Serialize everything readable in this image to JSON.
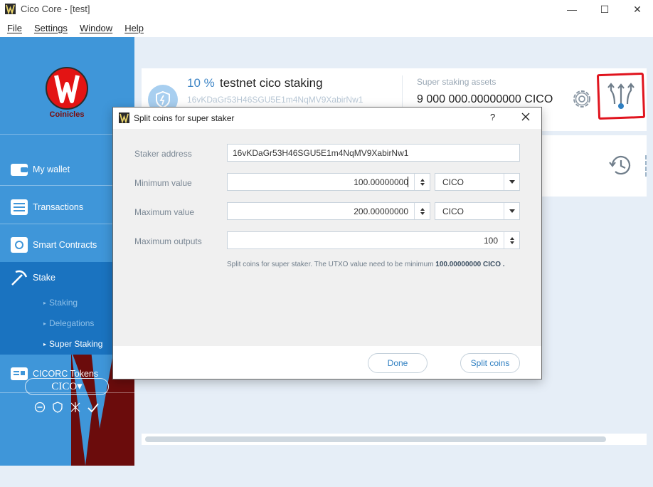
{
  "window": {
    "title": "Cico Core - [test]",
    "min_glyph": "—",
    "max_glyph": "☐",
    "close_glyph": "✕"
  },
  "menu": [
    "File",
    "Settings",
    "Window",
    "Help"
  ],
  "sidebar": {
    "logo_text": "Coinicles",
    "nav": {
      "wallet": "My wallet",
      "transactions": "Transactions",
      "contracts": "Smart Contracts",
      "stake": "Stake",
      "tokens": "CICORC Tokens"
    },
    "stake_sub": [
      "Staking",
      "Delegations",
      "Super Staking"
    ],
    "unit_selector": "CICO▾"
  },
  "staker_card": {
    "percent": "10 %",
    "name": "testnet cico staking",
    "address": "16vKDaGr53H46SGU5E1m4NqMV9XabirNw1",
    "assets_label": "Super staking assets",
    "assets_value": "9 000 000.00000000 CICO"
  },
  "dialog": {
    "title": "Split coins for super staker",
    "help": "?",
    "fields": {
      "staker_address_label": "Staker address",
      "staker_address_value": "16vKDaGr53H46SGU5E1m4NqMV9XabirNw1",
      "min_label": "Minimum value",
      "min_value": "100.00000000",
      "min_unit": "CICO",
      "max_label": "Maximum value",
      "max_value": "200.00000000",
      "max_unit": "CICO",
      "outputs_label": "Maximum outputs",
      "outputs_value": "100"
    },
    "note_prefix": "Split coins for super staker. The UTXO value need to be minimum ",
    "note_amount": "100.00000000 CICO",
    "note_suffix": " .",
    "done_button": "Done",
    "split_button": "Split coins"
  },
  "colors": {
    "sidebar": "#3f96d9",
    "sidebar_active": "#1a73c0",
    "accent": "#2f7fc1",
    "highlight": "#e0141e"
  }
}
